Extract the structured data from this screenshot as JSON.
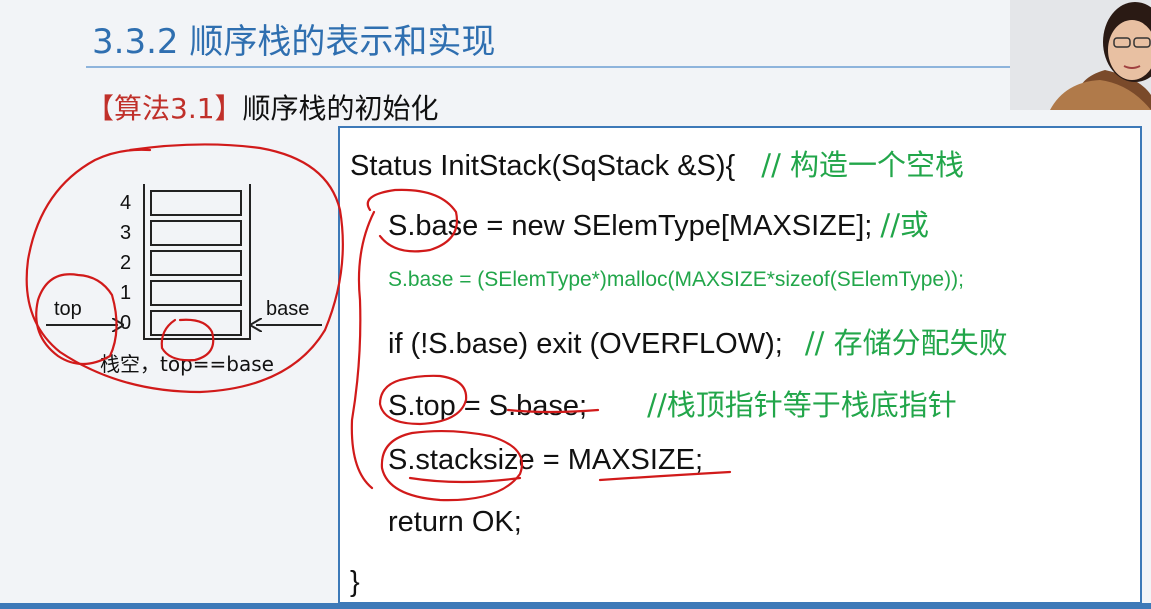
{
  "header": {
    "title": "3.3.2 顺序栈的表示和实现",
    "algo_tag": "【算法3.1】",
    "algo_title": "顺序栈的初始化"
  },
  "diagram": {
    "indices": [
      "4",
      "3",
      "2",
      "1",
      "0"
    ],
    "top_label": "top",
    "base_label": "base",
    "caption": "栈空，top==base"
  },
  "code": {
    "line1": "Status InitStack(SqStack   &S){",
    "line1_comment": "// 构造一个空栈",
    "line2": "S.base = new SElemType[MAXSIZE];",
    "line2_comment": "//或",
    "line3": "S.base = (SElemType*)malloc(MAXSIZE*sizeof(SElemType));",
    "line4": "if  (!S.base) exit  (OVERFLOW);",
    "line4_comment": "// 存储分配失败",
    "line5": "S.top = S.base;",
    "line5_comment": "//栈顶指针等于栈底指针",
    "line6": "S.stacksize = MAXSIZE;",
    "line7": "return OK;",
    "line8": "}"
  },
  "colors": {
    "title_blue": "#2f6fb0",
    "tag_red": "#c0302a",
    "comment_green": "#22a64a",
    "annotation_red": "#d11a1a",
    "box_border": "#3d79b8"
  }
}
